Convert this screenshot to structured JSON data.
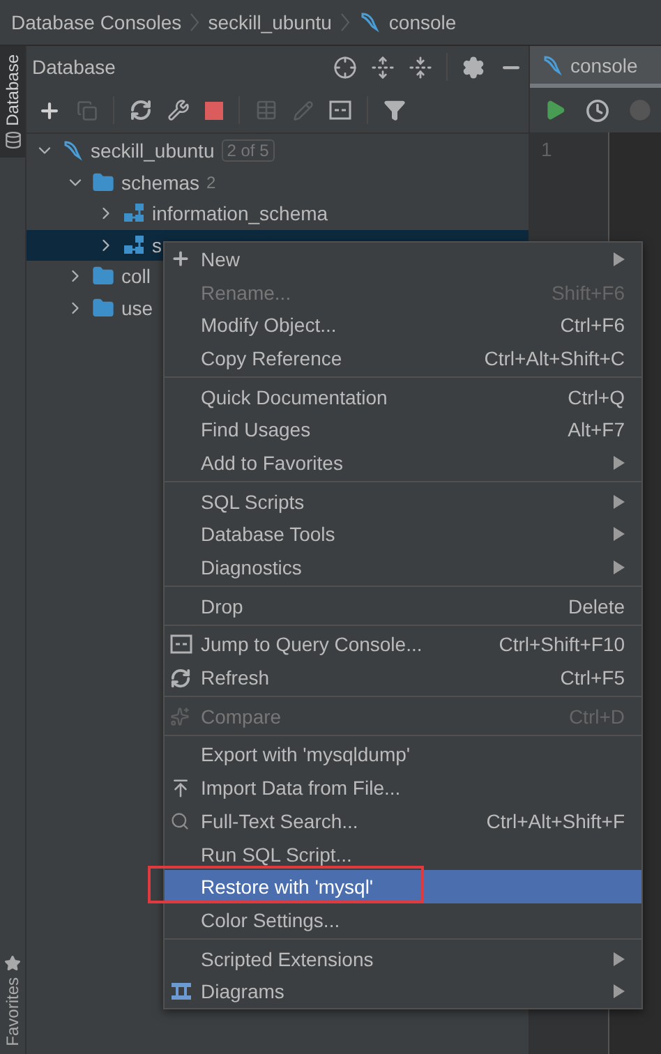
{
  "breadcrumb": [
    {
      "label": "Database Consoles",
      "kind": "plain"
    },
    {
      "label": "seckill_ubuntu",
      "kind": "plain"
    },
    {
      "label": "console",
      "kind": "console"
    }
  ],
  "side_tabs": [
    {
      "label": "Database",
      "kind": "database",
      "selected": true
    },
    {
      "label": "Favorites",
      "kind": "favorites",
      "selected": false
    }
  ],
  "database_panel": {
    "title": "Database",
    "tree": [
      {
        "label": "seckill_ubuntu",
        "kind": "datasource",
        "badge": "2 of 5",
        "expanded": true,
        "selected": false,
        "children": [
          {
            "label": "schemas",
            "kind": "folder",
            "count": "2",
            "expanded": true,
            "selected": false,
            "children": [
              {
                "label": "information_schema",
                "kind": "schema",
                "expanded": false,
                "selected": false
              },
              {
                "label": "s",
                "kind": "schema",
                "expanded": false,
                "selected": true
              }
            ]
          },
          {
            "label": "coll",
            "kind": "folder",
            "expanded": false,
            "selected": false
          },
          {
            "label": "use",
            "kind": "folder",
            "expanded": false,
            "selected": false
          }
        ]
      }
    ]
  },
  "console_tab": {
    "label": "console",
    "selected": true
  },
  "editor": {
    "line_numbers": [
      "1"
    ]
  },
  "context_menu": {
    "sections": [
      [
        {
          "label": "New",
          "kind": "plus",
          "submenu": true,
          "disabled": false,
          "selected": false
        },
        {
          "label": "Rename...",
          "shortcut": "Shift+F6",
          "disabled": true,
          "selected": false
        },
        {
          "label": "Modify Object...",
          "shortcut": "Ctrl+F6",
          "disabled": false,
          "selected": false
        },
        {
          "label": "Copy Reference",
          "shortcut": "Ctrl+Alt+Shift+C",
          "disabled": false,
          "selected": false
        }
      ],
      [
        {
          "label": "Quick Documentation",
          "shortcut": "Ctrl+Q",
          "disabled": false,
          "selected": false
        },
        {
          "label": "Find Usages",
          "shortcut": "Alt+F7",
          "disabled": false,
          "selected": false
        },
        {
          "label": "Add to Favorites",
          "submenu": true,
          "disabled": false,
          "selected": false
        }
      ],
      [
        {
          "label": "SQL Scripts",
          "submenu": true,
          "disabled": false,
          "selected": false
        },
        {
          "label": "Database Tools",
          "submenu": true,
          "disabled": false,
          "selected": false
        },
        {
          "label": "Diagnostics",
          "submenu": true,
          "disabled": false,
          "selected": false
        }
      ],
      [
        {
          "label": "Drop",
          "shortcut": "Delete",
          "disabled": false,
          "selected": false
        }
      ],
      [
        {
          "label": "Jump to Query Console...",
          "kind": "console",
          "shortcut": "Ctrl+Shift+F10",
          "disabled": false,
          "selected": false
        },
        {
          "label": "Refresh",
          "kind": "refresh",
          "shortcut": "Ctrl+F5",
          "disabled": false,
          "selected": false
        }
      ],
      [
        {
          "label": "Compare",
          "kind": "compare",
          "shortcut": "Ctrl+D",
          "disabled": true,
          "selected": false
        }
      ],
      [
        {
          "label": "Export with 'mysqldump'",
          "disabled": false,
          "selected": false
        },
        {
          "label": "Import Data from File...",
          "kind": "import",
          "disabled": false,
          "selected": false
        },
        {
          "label": "Full-Text Search...",
          "kind": "search",
          "shortcut": "Ctrl+Alt+Shift+F",
          "disabled": false,
          "selected": false
        },
        {
          "label": "Run SQL Script...",
          "disabled": false,
          "selected": false
        },
        {
          "label": "Restore with 'mysql'",
          "disabled": false,
          "selected": true,
          "annotated": true
        },
        {
          "label": "Color Settings...",
          "disabled": false,
          "selected": false
        }
      ],
      [
        {
          "label": "Scripted Extensions",
          "submenu": true,
          "disabled": false,
          "selected": false
        },
        {
          "label": "Diagrams",
          "kind": "diagram",
          "submenu": true,
          "disabled": false,
          "selected": false
        }
      ]
    ]
  }
}
